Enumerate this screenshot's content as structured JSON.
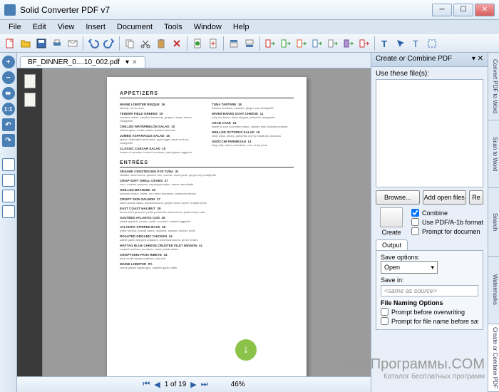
{
  "window": {
    "title": "Solid Converter PDF v7"
  },
  "menu": [
    "File",
    "Edit",
    "View",
    "Insert",
    "Document",
    "Tools",
    "Window",
    "Help"
  ],
  "tab": {
    "name": "BF_DINNER_0....10_002.pdf"
  },
  "page_nav": {
    "current": "1 of 19",
    "zoom": "46%"
  },
  "sidebar_tabs": [
    "Convert PDF to Word",
    "Scan to Word",
    "Search",
    "Watermarks",
    "Create or Combine PDF"
  ],
  "right_panel": {
    "title": "Create or Combine PDF",
    "files_label": "Use these file(s):",
    "browse": "Browse...",
    "add_open": "Add open files",
    "reset": "Re",
    "create": "Create",
    "combine": "Combine",
    "pdfa": "Use PDF/A-1b format",
    "prompt_doc": "Prompt for documen",
    "output_tab": "Output",
    "save_options_label": "Save options:",
    "save_options_value": "Open",
    "save_in_label": "Save in:",
    "save_in_value": "<same as source>",
    "naming": "File Naming Options",
    "prompt_overwrite": "Prompt before overwriting",
    "prompt_filename": "Prompt for file name before saving"
  },
  "doc": {
    "h1": "APPETIZERS",
    "h2": "ENTRÉES",
    "app_left": [
      {
        "n": "MAINE LOBSTER BISQUE",
        "d": "shrimp, vol au vent",
        "p": "16"
      },
      {
        "n": "TENDER FIELD GREENS",
        "d": "summer radish, candied hazelnuts, grapes, meyer lemon vinaigrette",
        "p": "10"
      },
      {
        "n": "CHILLED WATERMELON SALAD",
        "d": "wild arugula, ricotta salata, toasted almonds",
        "p": "10"
      },
      {
        "n": "JUMBO ASPARAGUS SALAD",
        "d": "speck, marinated anchovies, quail eggs, caper leaf nut vinaigrette",
        "p": "16"
      },
      {
        "n": "CLASSIC CAESAR SALAD",
        "d": "hearts of romaine, herbed croutons, parmigiano reggiano",
        "p": "10"
      }
    ],
    "app_right": [
      {
        "n": "TUNA TARTARE",
        "d": "wonton croutons, sesame, ginger, soy vinaigrette",
        "p": "16"
      },
      {
        "n": "WARM BAKED GOAT CHEESE",
        "d": "ruby red beets, baby arugula, pistachio vinaigrette",
        "p": "11"
      },
      {
        "n": "CRAB CAKE",
        "d": "sweet & sour cucumber salad, cilantro aioli, toasted peanuts",
        "p": "15"
      },
      {
        "n": "GRILLED OCTOPUS SALAD",
        "d": "chick peas, olives, pancetta, cherry tomatoes, focaccia",
        "p": "16"
      },
      {
        "n": "GNOCCHI PARMESAN",
        "d": "king crab, cherry tomatoes, corn, snap peas",
        "p": "14"
      }
    ],
    "ent": [
      {
        "n": "SESAME CRUSTED BIG EYE TUNA",
        "d": "shiitake mushrooms, jasmine rice, carrots, snow peas, ginger soy vinaigrette",
        "p": "31"
      },
      {
        "n": "CRISP SOFT SHELL CRABS",
        "d": "corn, roasted peppers, asparagus salad, sauce remoulade",
        "p": "27"
      },
      {
        "n": "GRILLED BRANZINI",
        "d": "summer beans, olives, sun dried tomatoes, preserved lemon",
        "p": "29"
      },
      {
        "n": "CRISPY SKIN SALMON",
        "d": "warm potato salad, smoked bacon, ginger carrot puree, english peas",
        "p": "27"
      },
      {
        "n": "EAST COAST HALIBUT",
        "d": "lemon herb gnocchi, petite portobello mushrooms, jumbo lump crab",
        "p": "29"
      },
      {
        "n": "SAUTÉED ATLANTIC COD",
        "d": "wilted spinach, tomato confit, zucchini, roasted eggplant",
        "p": "26"
      },
      {
        "n": "ATLANTIC STRIPED BASS",
        "d": "petite shrimp, manila clams, mussels, smoked chorizo broth",
        "p": "28"
      },
      {
        "n": "ROASTED ORGANIC CHICKEN",
        "d": "sweet garlic whipped potatoes, wild mushrooms, green beans",
        "p": "24"
      },
      {
        "n": "MAYTAG BLUE CHEESE CRUSTED FILET MIGNON",
        "d": "roasted heirloom tomatoes, basil, potato sticks",
        "p": "41"
      },
      {
        "n": "CRISPYSKIN PANA RIBEYE",
        "d": "duck confit risotto potatoes, sea salt",
        "p": "34"
      },
      {
        "n": "MAINE LOBSTER",
        "d": "ravioli glazed asparagus, roasted garlic butter",
        "p": "PA"
      }
    ]
  },
  "watermark": {
    "t1": "МоиПрограммы.COM",
    "t2": "Каталог бесплатных программ"
  }
}
